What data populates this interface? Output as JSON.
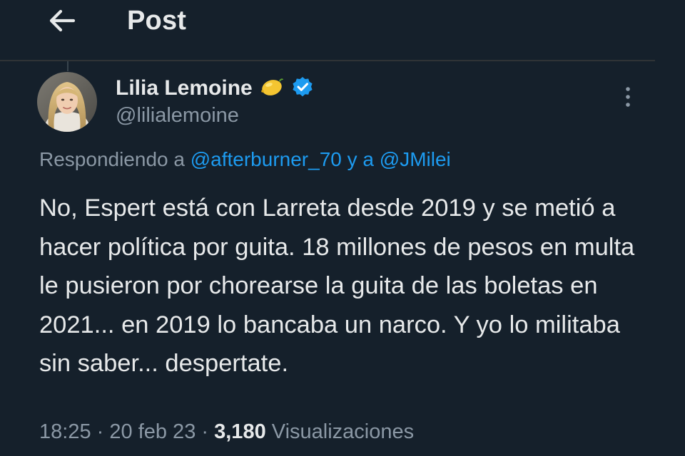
{
  "header": {
    "title": "Post",
    "back_icon": "arrow-left-icon"
  },
  "post": {
    "author": {
      "display_name": "Lilia Lemoine",
      "emoji": "🍋",
      "handle": "@lilialemoine",
      "verified": true,
      "verified_color": "#1d9bf0",
      "avatar_icon": "avatar-photo"
    },
    "reply_to": {
      "prefix": "Respondiendo a",
      "mention_1": "@afterburner_70",
      "conjunction": "y a",
      "mention_2": "@JMilei"
    },
    "text": "No, Espert está con Larreta desde 2019 y se metió a hacer política por guita. 18 millones de pesos en multa le pusieron por chorearse la guita de las boletas en 2021... en 2019 lo bancaba un narco. Y yo lo militaba sin saber... despertate.",
    "meta": {
      "time": "18:25",
      "separator": "·",
      "date": "20 feb 23",
      "views_count": "3,180",
      "views_label": "Visualizaciones"
    }
  },
  "colors": {
    "background": "#15202b",
    "text_primary": "#e7e9ea",
    "text_secondary": "#8b98a5",
    "accent": "#1d9bf0",
    "divider": "#2f3336"
  }
}
